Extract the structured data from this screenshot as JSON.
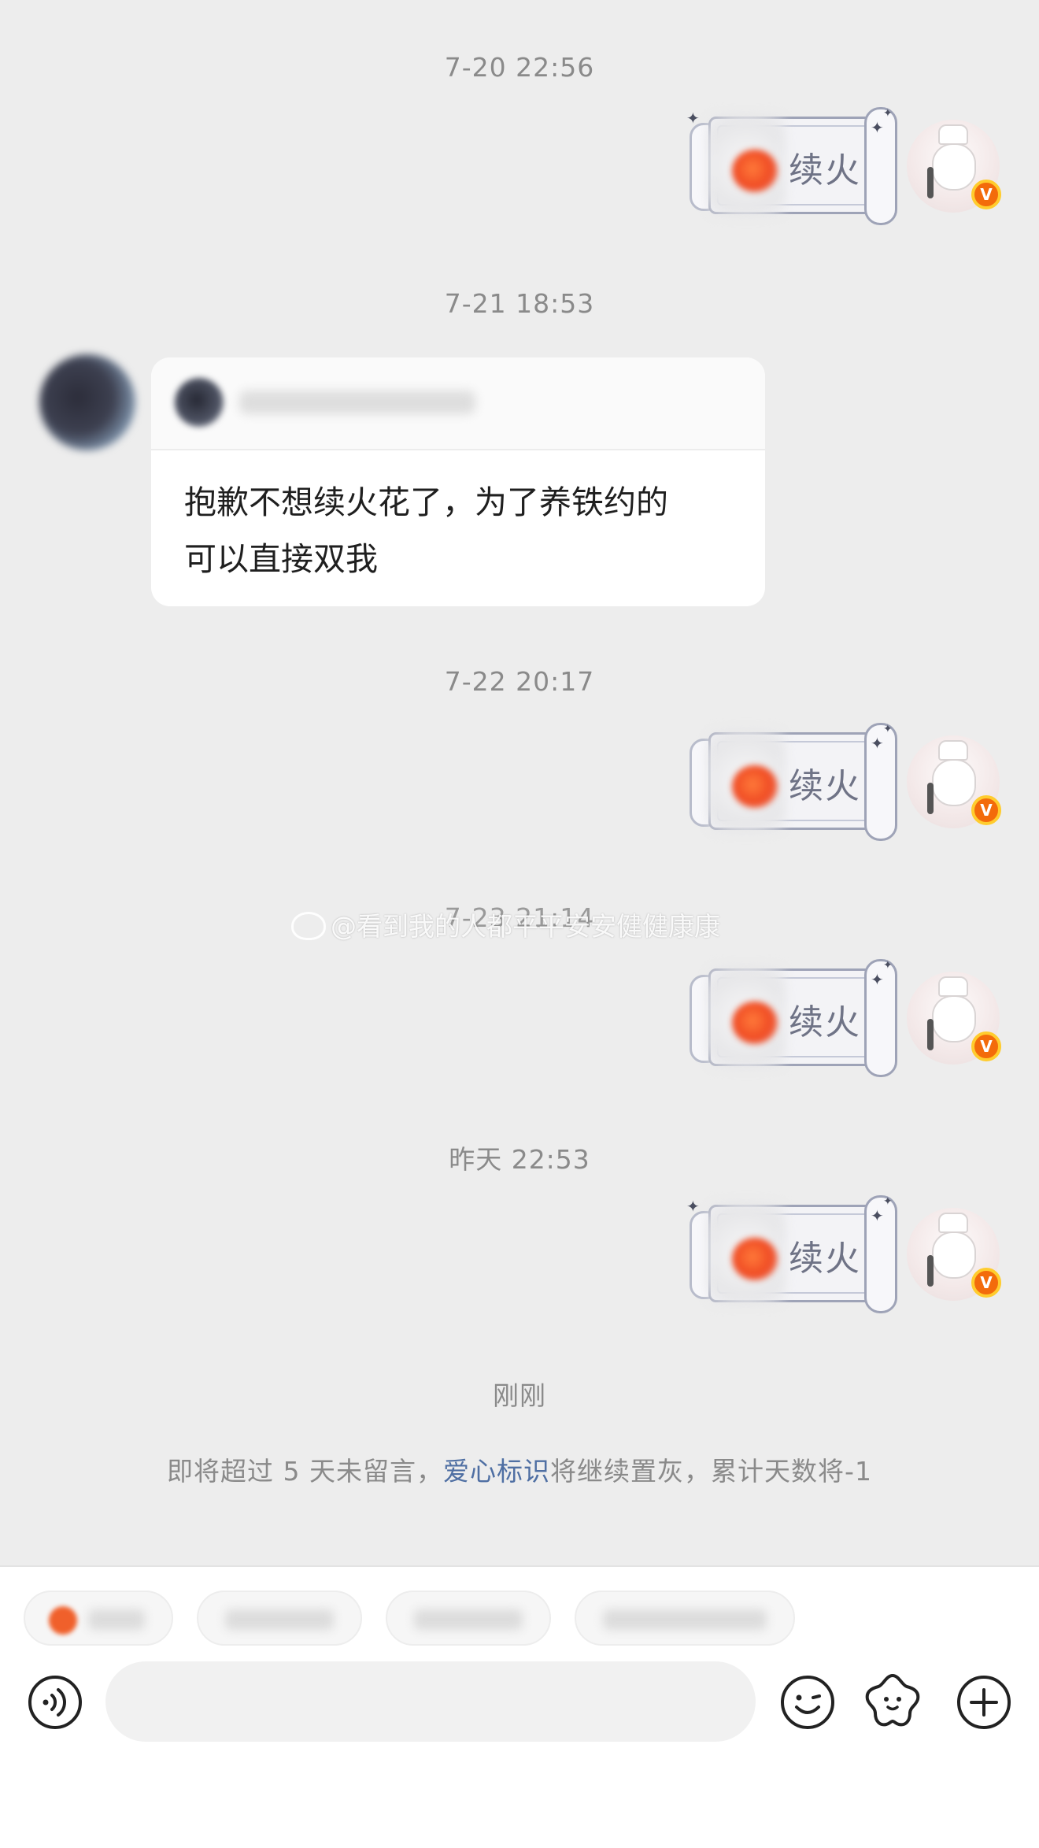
{
  "timestamps": {
    "t1": "7-20 22:56",
    "t2": "7-21 18:53",
    "t3": "7-22 20:17",
    "t4": "7-23 21:14",
    "t5": "昨天 22:53",
    "t6": "刚刚"
  },
  "sticker_label": "续火",
  "incoming_message": {
    "text_line1": "抱歉不想续火花了，为了养铁约的",
    "text_line2": "可以直接双我"
  },
  "watermark": "@看到我的人都平平安安健健康康",
  "notice": {
    "prefix": "即将超过 5 天未留言，",
    "link": "爱心标识",
    "suffix": "将继续置灰，累计天数将-1"
  },
  "badge": "V",
  "input": {
    "placeholder": ""
  },
  "icons": [
    "voice-icon",
    "emoji-icon",
    "sticker-icon",
    "plus-icon"
  ],
  "colors": {
    "background": "#ededed",
    "link": "#4f6fa3",
    "badge": "#f36b0b"
  }
}
